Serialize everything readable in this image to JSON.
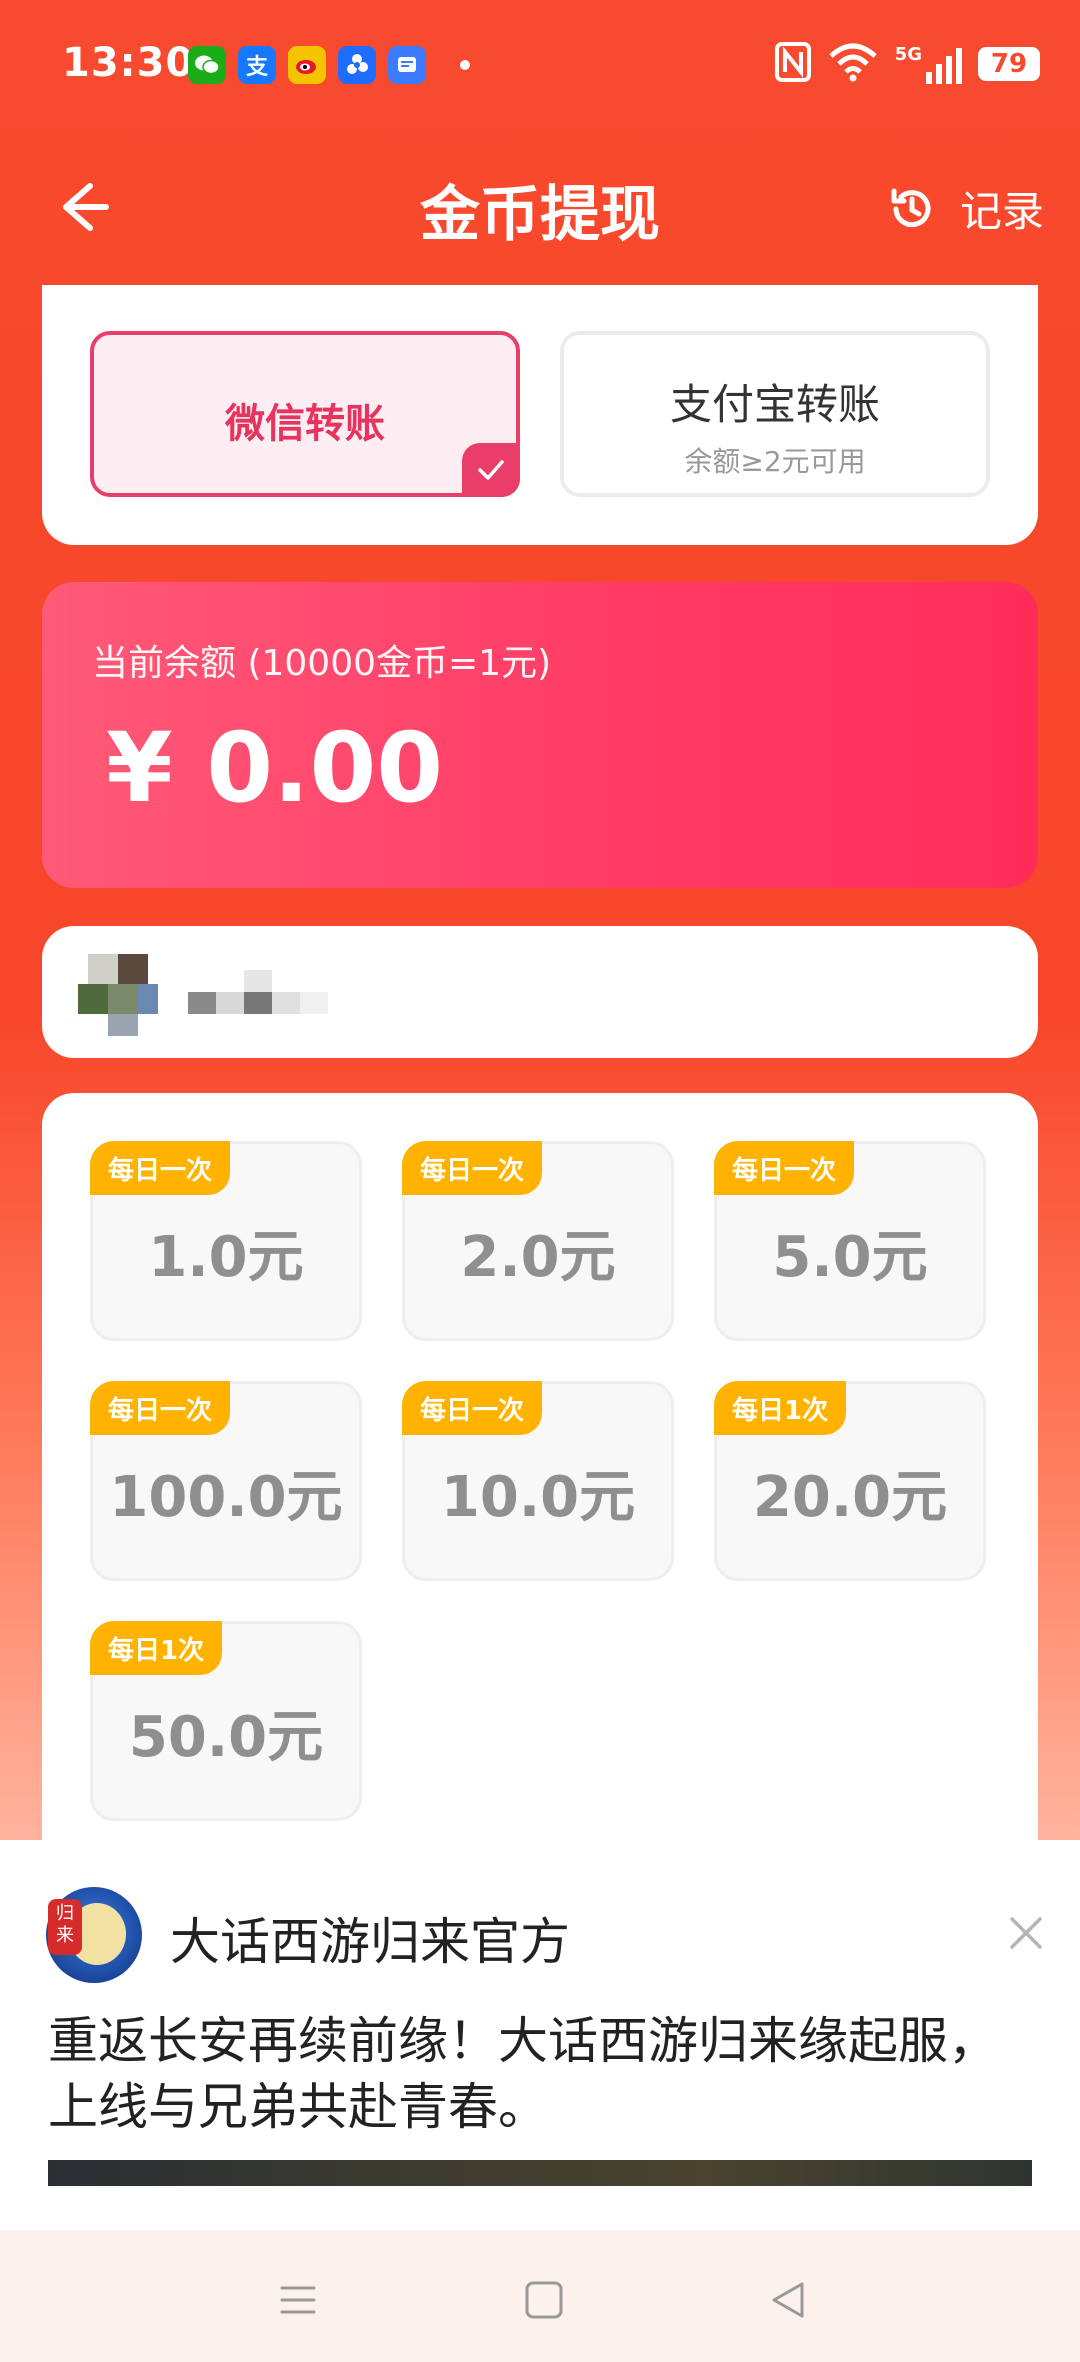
{
  "status_bar": {
    "time": "13:30",
    "notification_icons": [
      "wechat-icon",
      "alipay-icon",
      "weibo-icon",
      "pinwheel-app-icon",
      "message-app-icon"
    ],
    "alipay_glyph": "支",
    "battery": "79",
    "network": "5G"
  },
  "header": {
    "title": "金币提现",
    "record_label": "记录"
  },
  "payment": {
    "wechat_label": "微信转账",
    "alipay_label": "支付宝转账",
    "alipay_sub": "余额≥2元可用",
    "selected": "wechat"
  },
  "balance": {
    "label": "当前余额 (10000金币=1元)",
    "value": "¥ 0.00"
  },
  "amounts": [
    {
      "tag": "每日一次",
      "value": "1.0元"
    },
    {
      "tag": "每日一次",
      "value": "2.0元"
    },
    {
      "tag": "每日一次",
      "value": "5.0元"
    },
    {
      "tag": "每日一次",
      "value": "100.0元"
    },
    {
      "tag": "每日一次",
      "value": "10.0元"
    },
    {
      "tag": "每日1次",
      "value": "20.0元"
    },
    {
      "tag": "每日1次",
      "value": "50.0元"
    }
  ],
  "ad": {
    "logo_text": "归来",
    "name": "大话西游归来官方",
    "text": "重返长安再续前缘！大话西游归来缘起服，上线与兄弟共赴青春。"
  },
  "colors": {
    "background": "#f84a2e",
    "accent": "#e93d6a",
    "tag": "#ffb300"
  }
}
